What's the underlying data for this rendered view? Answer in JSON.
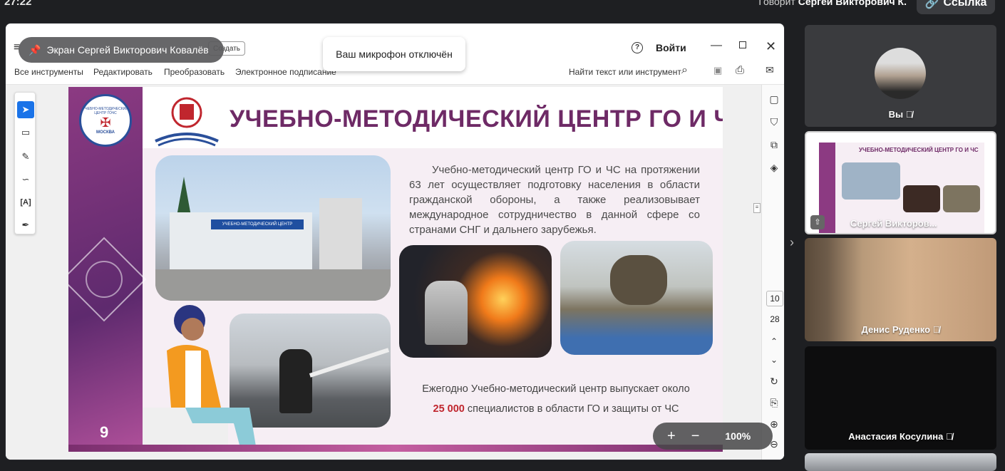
{
  "top": {
    "clock": "27:22",
    "speaking_prefix": "Говорит",
    "speaking_name": "Сергей Викторович К.",
    "link_button": "Ссылка"
  },
  "presenter_label": "Экран Сергей Викторович Ковалёв",
  "mic_toast": "Ваш микрофон отключён",
  "acrobat": {
    "signin": "Войти",
    "create": "Создать",
    "menu": [
      "Все инструменты",
      "Редактировать",
      "Преобразовать",
      "Электронное подписание"
    ],
    "search": "Найти текст или инструмент",
    "page_current": "10",
    "page_total": "28",
    "zoom": "100%"
  },
  "slide": {
    "seal_lines": [
      "УЧЕБНО-МЕТОДИЧЕСКИЙ ЦЕНТР ГОЧС",
      "МОСКВА"
    ],
    "title": "УЧЕБНО-МЕТОДИЧЕСКИЙ ЦЕНТР ГО И ЧС",
    "building_sign": "УЧЕБНО-МЕТОДИЧЕСКИЙ ЦЕНТР",
    "paragraph": "Учебно-методический центр ГО и ЧС на протяжении 63 лет осуществляет подготовку населения в области гражданской обороны, а также реализовывает международное сотрудничество в данной сфере со странами СНГ и дальнего зарубежья.",
    "bottom_line1": "Ежегодно Учебно-методический центр выпускает около",
    "bottom_highlight": "25 000",
    "bottom_line2": "специалистов в области ГО и защиты от ЧС",
    "page_number": "9"
  },
  "participants": [
    {
      "name": "Вы"
    },
    {
      "name": "Сергей Викторов..."
    },
    {
      "name": "Денис Руденко"
    },
    {
      "name": "Анастасия Косулина"
    }
  ],
  "colors": {
    "accent": "#7a2e6e",
    "highlight": "#c0262e",
    "dark_bg": "#1e1f22"
  }
}
